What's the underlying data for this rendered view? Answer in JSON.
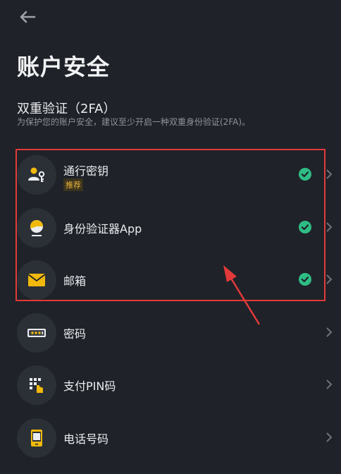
{
  "header": {
    "back_icon": "back-arrow-icon"
  },
  "page": {
    "title": "账户安全"
  },
  "twofa": {
    "title": "双重验证（2FA）",
    "description": "为保护您的账户安全，建议至少开启一种双重身份验证(2FA)。"
  },
  "items": [
    {
      "label": "通行密钥",
      "tag": "推荐",
      "icon": "passkey-icon",
      "enabled": true
    },
    {
      "label": "身份验证器App",
      "icon": "authenticator-icon",
      "enabled": true
    },
    {
      "label": "邮箱",
      "icon": "email-icon",
      "enabled": true
    },
    {
      "label": "密码",
      "icon": "password-icon",
      "enabled": false
    },
    {
      "label": "支付PIN码",
      "icon": "payment-pin-icon",
      "enabled": false
    },
    {
      "label": "电话号码",
      "icon": "phone-icon",
      "enabled": false
    }
  ],
  "colors": {
    "background": "#1f2228",
    "accent_yellow": "#f0b90b",
    "check_green": "#2ebd85",
    "annotation_red": "#e23a3a"
  }
}
